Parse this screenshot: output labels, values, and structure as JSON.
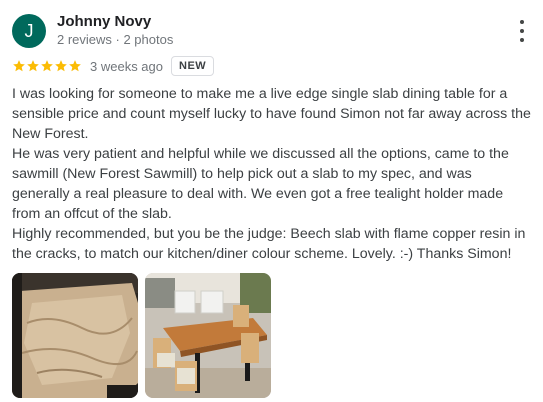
{
  "author": {
    "initial": "J",
    "name": "Johnny Novy",
    "meta": "2 reviews · 2 photos",
    "avatar_color": "#00695c"
  },
  "review": {
    "rating": 5,
    "rating_max": 5,
    "time": "3 weeks ago",
    "badge": "NEW",
    "star_color": "#fbbc04",
    "paragraphs": [
      "I was looking for someone to make me a live edge single slab dining table for a sensible price and count myself lucky to have found Simon not far away across the New Forest.",
      "He was very patient and helpful while we discussed all the options, came to the sawmill (New Forest Sawmill) to help pick out a slab to my spec, and was generally a real pleasure to deal with. We even got a free tealight holder made from an offcut of the slab.",
      "Highly recommended, but you be the judge: Beech slab with flame copper resin in the cracks, to match our kitchen/diner colour scheme. Lovely. :-) Thanks Simon!"
    ]
  },
  "icons": {
    "more": "more-vert-icon",
    "star": "star-icon"
  }
}
